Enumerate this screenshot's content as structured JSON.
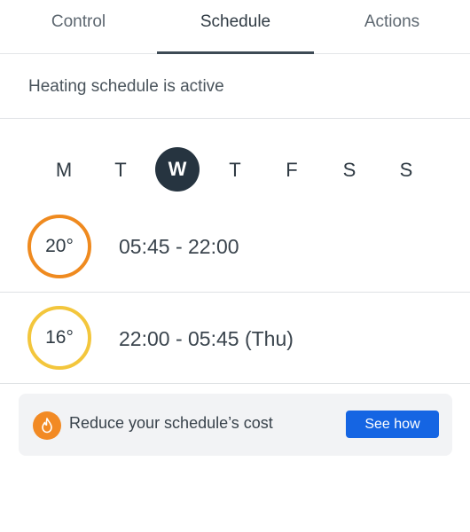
{
  "tabs": [
    {
      "label": "Control"
    },
    {
      "label": "Schedule"
    },
    {
      "label": "Actions"
    }
  ],
  "active_tab": "Schedule",
  "status": {
    "text": "Heating schedule is active"
  },
  "days": [
    {
      "label": "M"
    },
    {
      "label": "T"
    },
    {
      "label": "W"
    },
    {
      "label": "T"
    },
    {
      "label": "F"
    },
    {
      "label": "S"
    },
    {
      "label": "S"
    }
  ],
  "selected_day": "W",
  "slots": [
    {
      "temperature": "20°",
      "time": "05:45 - 22:00",
      "color": "#ef8a1f"
    },
    {
      "temperature": "16°",
      "time": "22:00 - 05:45 (Thu)",
      "color": "#f3c63c"
    }
  ],
  "promo": {
    "icon": "flame-savings-icon",
    "text": "Reduce your schedule’s cost",
    "button_label": "See how",
    "button_color": "#1565e3",
    "icon_color": "#f28a24"
  }
}
